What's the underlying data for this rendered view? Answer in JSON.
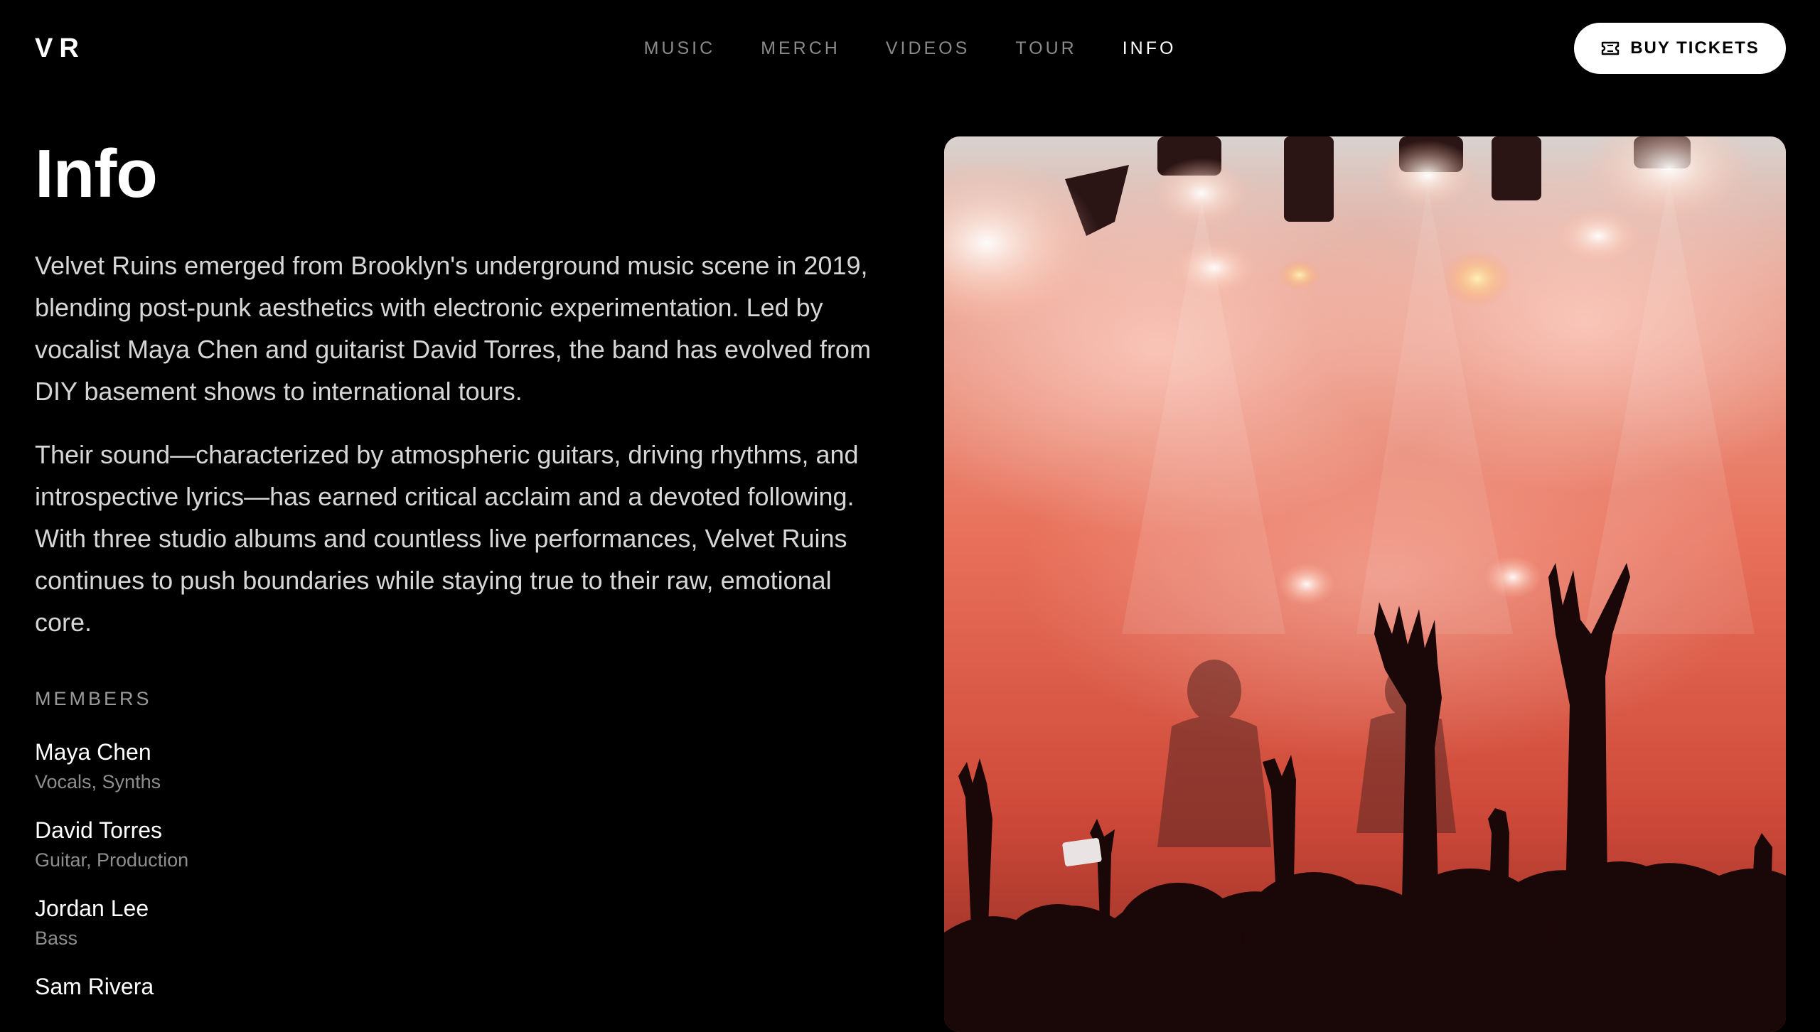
{
  "header": {
    "logo": "VR",
    "nav": [
      {
        "label": "MUSIC"
      },
      {
        "label": "MERCH"
      },
      {
        "label": "VIDEOS"
      },
      {
        "label": "TOUR"
      },
      {
        "label": "INFO",
        "active": true
      }
    ],
    "buy_tickets_label": "BUY TICKETS",
    "buy_tickets_icon": "ticket-icon"
  },
  "main": {
    "title": "Info",
    "paragraphs": [
      "Velvet Ruins emerged from Brooklyn's underground music scene in 2019, blending post-punk aesthetics with electronic experimentation. Led by vocalist Maya Chen and guitarist David Torres, the band has evolved from DIY basement shows to international tours.",
      "Their sound—characterized by atmospheric guitars, driving rhythms, and introspective lyrics—has earned critical acclaim and a devoted following. With three studio albums and countless live performances, Velvet Ruins continues to push boundaries while staying true to their raw, emotional core."
    ],
    "members_heading": "MEMBERS",
    "members": [
      {
        "name": "Maya Chen",
        "role": "Vocals, Synths"
      },
      {
        "name": "David Torres",
        "role": "Guitar, Production"
      },
      {
        "name": "Jordan Lee",
        "role": "Bass"
      },
      {
        "name": "Sam Rivera",
        "role": ""
      }
    ]
  },
  "colors": {
    "background": "#000000",
    "nav_inactive": "#8a8a8a",
    "nav_active": "#ffffff",
    "button_bg": "#ffffff",
    "body_text": "#d6d6d6",
    "muted_text": "#8e8e8e",
    "photo_tone": "#e0573f"
  }
}
